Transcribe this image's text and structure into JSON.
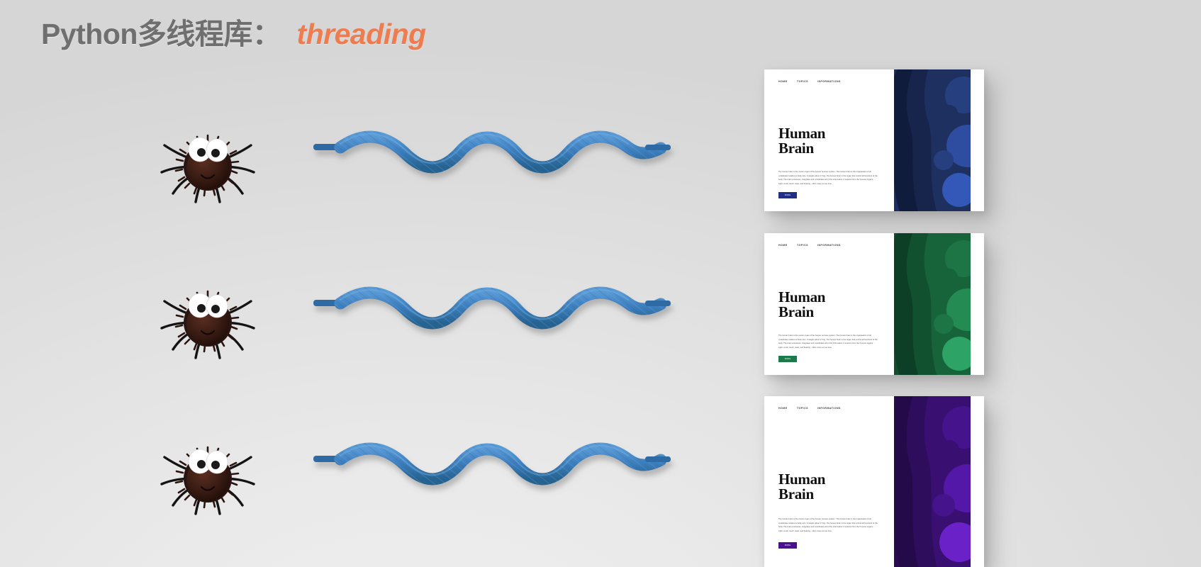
{
  "title": {
    "main": "Python多线程库：",
    "accent": "threading",
    "main_color": "#6f6f6f",
    "accent_color": "#ef7c4e"
  },
  "background": {
    "gradient_from": "#cfcfcf",
    "gradient_to": "#ececec"
  },
  "rows": [
    {
      "spider_name": "spider-illustration-1",
      "thread_name": "blue-thread-illustration-1"
    },
    {
      "spider_name": "spider-illustration-2",
      "thread_name": "blue-thread-illustration-2"
    },
    {
      "spider_name": "spider-illustration-3",
      "thread_name": "blue-thread-illustration-3"
    }
  ],
  "spider": {
    "body_color": "#3a2018",
    "leg_color": "#141414",
    "eye_color": "#ffffff",
    "pupil_color": "#1a1a1a"
  },
  "thread": {
    "color": "#3d7fbe",
    "color_dark": "#2e6396",
    "aglet_color": "#2f6aa3"
  },
  "cards": [
    {
      "nav": [
        "HOME",
        "TOPICS",
        "INFORMATIONS"
      ],
      "heading_line1": "Human",
      "heading_line2": "Brain",
      "body": "The human brain is the center organ of the human nervous system. The human brain is the organisation of all vertebrates relative to body size. It weighs about 1.5 kg. The human brain is the organ that control all functions of the body. The brain processes, integrates and coordinates all of the information it receives from the 5 sense organs - sight, smell, touch, taste, and hearing - often many at one time.",
      "cta_label": "MORE",
      "accent": "#1f2f87",
      "art_colors": [
        "#101c3c",
        "#17244b",
        "#1d3060",
        "#26407f",
        "#2e4da0",
        "#3358b8",
        "#1b2f66"
      ]
    },
    {
      "nav": [
        "HOME",
        "TOPICS",
        "INFORMATIONS"
      ],
      "heading_line1": "Human",
      "heading_line2": "Brain",
      "body": "The human brain is the center organ of the human nervous system. The human brain is the organisation of all vertebrates relative to body size. It weighs about 1.5 kg. The human brain is the organ that control all functions of the body. The brain processes, integrates and coordinates all of the information it receives from the 5 sense organs - sight, smell, touch, taste, and hearing - often many at one time.",
      "cta_label": "MORE",
      "accent": "#1a7a4a",
      "art_colors": [
        "#0c3f26",
        "#11512f",
        "#17633a",
        "#1d7545",
        "#248b52",
        "#2da465",
        "#124d2d"
      ]
    },
    {
      "nav": [
        "HOME",
        "TOPICS",
        "INFORMATIONS"
      ],
      "heading_line1": "Human",
      "heading_line2": "Brain",
      "body": "The human brain is the center organ of the human nervous system. The human brain is the organisation of all vertebrates relative to body size. It weighs about 1.5 kg. The human brain is the organ that control all functions of the body. The brain processes, integrates and coordinates all of the information it receives from the 5 sense organs - sight, smell, touch, taste, and hearing - often many at one time.",
      "cta_label": "MORE",
      "accent": "#4b1090",
      "art_colors": [
        "#250a4a",
        "#2e0d5c",
        "#390f72",
        "#45138c",
        "#5418a8",
        "#6a22c8",
        "#2a0b52"
      ]
    }
  ]
}
